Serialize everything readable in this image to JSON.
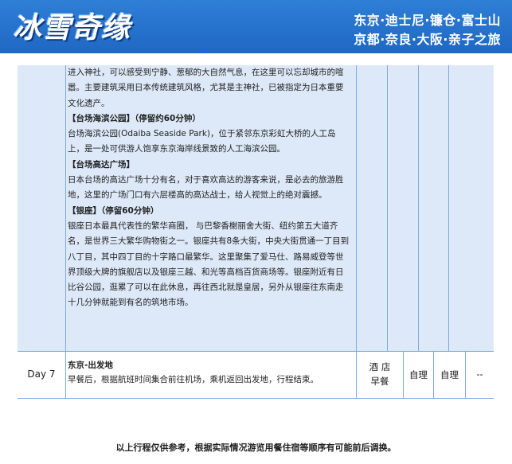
{
  "header": {
    "logo_text": "冰雪奇缘",
    "route_line1": "东京·迪士尼·镰仓·富士山",
    "route_line2": "京都·奈良·大阪·亲子之旅"
  },
  "itinerary": {
    "row_continued": {
      "paragraphs": [
        {
          "kind": "text",
          "text": "进入神社，可以感受到宁静、葱郁的大自然气息，在这里可以忘却城市的喧嚣。主要建筑采用日本传统建筑风格，尤其是主神社，已被指定为日本重要文化遗产。"
        },
        {
          "kind": "title",
          "text": "【台场海滨公园】（停留约60分钟）"
        },
        {
          "kind": "text",
          "text": "台场海滨公园(Odaiba Seaside Park)，位于紧邻东京彩虹大桥的人工岛上，是一处可供游人饱享东京海岸线景致的人工海滨公园。"
        },
        {
          "kind": "title",
          "text": "【台场高达广场】"
        },
        {
          "kind": "text",
          "text": "日本台场的高达广场十分有名，对于喜欢高达的游客来说，是必去的旅游胜地，这里的广场门口有六层楼高的高达战士，给人视觉上的绝对震撼。"
        },
        {
          "kind": "title",
          "text": "【银座】（停留60分钟）"
        },
        {
          "kind": "text",
          "text": "银座日本最具代表性的繁华商圈， 与巴黎香榭丽舍大街、纽约第五大道齐名，是世界三大繁华购物街之一。银座共有8条大街，中央大街贯通一丁目到八丁目，其中四丁目的十字路口最繁华。这里聚集了爱马仕、路易威登等世界顶级大牌的旗舰店以及银座三越、和光等高档百货商场等。银座附近有日比谷公园，逛累了可以在此休息，再往西北就是皇居，另外从银座往东南走十几分钟就能到有名的筑地市场。"
        }
      ]
    },
    "day7": {
      "day_label": "Day 7",
      "title": "东京-出发地",
      "description": "早餐后，根据航班时间集合前往机场，乘机返回出发地，行程结束。",
      "meal_line1": "酒 店",
      "meal_line2": "早餐",
      "lunch": "自理",
      "dinner": "自理",
      "hotel": "--"
    }
  },
  "footnote": "以上行程仅供参考，根据实际情况游览用餐住宿等顺序有可能前后调换。",
  "colors": {
    "banner": "#1f67c4",
    "row_shade": "#dde9f8",
    "grid_line": "#7ea9dc"
  }
}
